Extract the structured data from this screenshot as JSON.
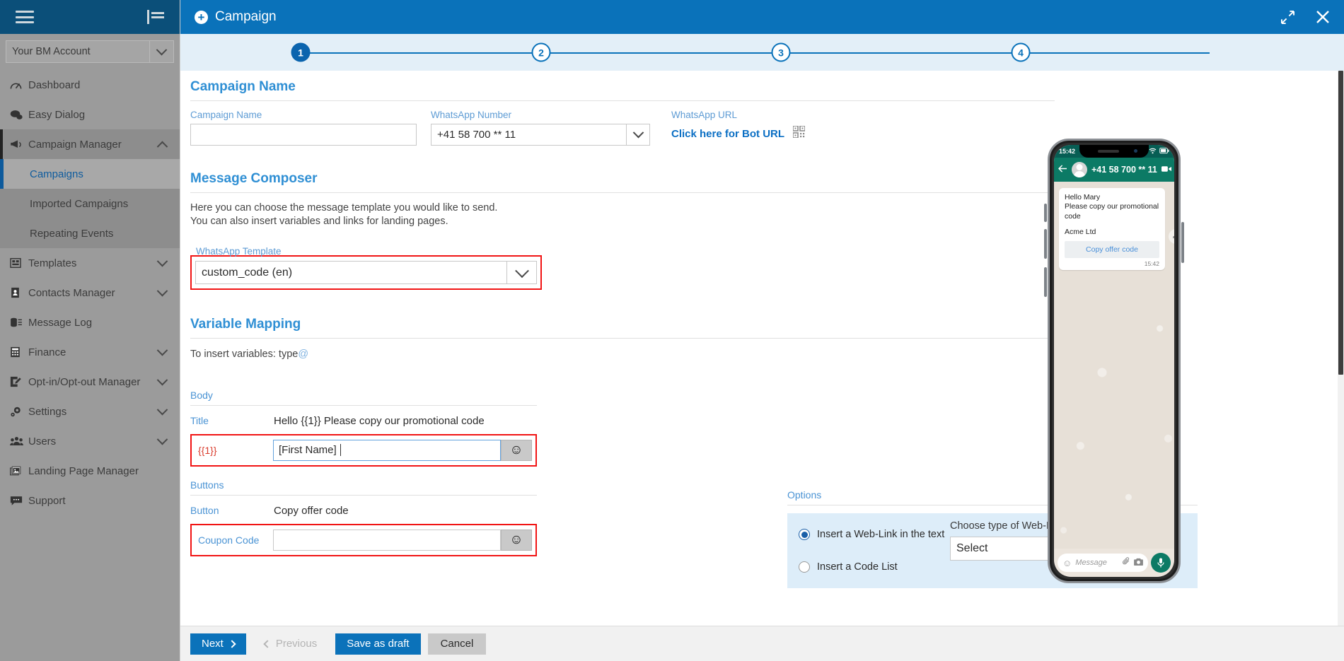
{
  "sidebar": {
    "account": {
      "label": "Your BM Account"
    },
    "items": [
      {
        "label": "Dashboard",
        "icon": "gauge-icon",
        "expandable": false
      },
      {
        "label": "Easy Dialog",
        "icon": "chat-bubbles-icon",
        "expandable": false
      },
      {
        "label": "Campaign Manager",
        "icon": "megaphone-icon",
        "expandable": true,
        "expanded": true
      },
      {
        "label": "Templates",
        "icon": "template-icon",
        "expandable": true
      },
      {
        "label": "Contacts Manager",
        "icon": "contacts-book-icon",
        "expandable": true
      },
      {
        "label": "Message Log",
        "icon": "database-list-icon",
        "expandable": false
      },
      {
        "label": "Finance",
        "icon": "calculator-icon",
        "expandable": true
      },
      {
        "label": "Opt-in/Opt-out Manager",
        "icon": "edit-square-icon",
        "expandable": true
      },
      {
        "label": "Settings",
        "icon": "gear-icon",
        "expandable": true
      },
      {
        "label": "Users",
        "icon": "users-icon",
        "expandable": true
      },
      {
        "label": "Landing Page Manager",
        "icon": "images-icon",
        "expandable": false
      },
      {
        "label": "Support",
        "icon": "support-chat-icon",
        "expandable": false
      }
    ],
    "submenu": [
      {
        "label": "Campaigns",
        "active": true
      },
      {
        "label": "Imported Campaigns",
        "active": false
      },
      {
        "label": "Repeating Events",
        "active": false
      }
    ]
  },
  "modal": {
    "title": "Campaign",
    "add_icon": "plus-circle-icon",
    "expand_icon": "expand-icon",
    "close_icon": "close-icon",
    "steps": [
      {
        "number": "1",
        "state": "done"
      },
      {
        "number": "2",
        "state": "todo"
      },
      {
        "number": "3",
        "state": "todo"
      },
      {
        "number": "4",
        "state": "todo"
      }
    ]
  },
  "campaign_name": {
    "heading": "Campaign Name",
    "name_label": "Campaign Name",
    "name_value": "",
    "whatsapp_number_label": "WhatsApp Number",
    "whatsapp_number_value": "+41 58 700 ** 11",
    "whatsapp_url_label": "WhatsApp URL",
    "bot_url_link": "Click here for Bot URL",
    "qr_icon": "qr-code-icon"
  },
  "message_composer": {
    "heading": "Message Composer",
    "hint_line1": "Here you can choose the message template you would like to send.",
    "hint_line2": "You can also insert variables and links for landing pages.",
    "template_label": "WhatsApp Template",
    "template_value": "custom_code (en)"
  },
  "variable_mapping": {
    "heading": "Variable Mapping",
    "hint_prefix": "To insert variables: type",
    "hint_symbol": "@",
    "body_header": "Body",
    "title_key": "Title",
    "title_value": "Hello {{1}} Please copy our promotional code",
    "var1_key": "{{1}}",
    "var1_value": "[First Name]",
    "buttons_header": "Buttons",
    "button_key": "Button",
    "button_value": "Copy offer code",
    "coupon_key": "Coupon Code",
    "coupon_value": "",
    "emoji_icon": "emoji-smiley-icon"
  },
  "options": {
    "heading": "Options",
    "radio_weblink": "Insert a Web-Link in the text",
    "radio_codelist": "Insert a Code List",
    "selected": "weblink",
    "weblink_type_label": "Choose type of Web-Link",
    "weblink_type_value": "Select"
  },
  "preview": {
    "status_time": "15:42",
    "battery_icon": "battery-icon",
    "wifi_icon": "wifi-icon",
    "signal_icon": "signal-icon",
    "back_icon": "back-arrow-icon",
    "avatar_icon": "avatar-icon",
    "contact": "+41 58 700 ** 11",
    "video_icon": "video-camera-icon",
    "call_icon": "phone-icon",
    "menu_icon": "kebab-menu-icon",
    "message_line1": "Hello Mary",
    "message_line2": "Please copy our promotional code",
    "company": "Acme Ltd",
    "cta_label": "Copy offer code",
    "message_time": "15:42",
    "forward_icon": "forward-arrow-icon",
    "composer_emoji_icon": "emoji-smiley-icon",
    "composer_placeholder": "Message",
    "attach_icon": "paperclip-icon",
    "camera_icon": "camera-icon",
    "mic_icon": "microphone-icon"
  },
  "footer": {
    "next": "Next",
    "previous": "Previous",
    "save_draft": "Save as draft",
    "cancel": "Cancel"
  },
  "colors": {
    "brand_blue": "#0a72ba",
    "sidebar_dark": "#0b4f79",
    "accent_link": "#2f8fd4",
    "highlight_red": "#f11414",
    "whatsapp_green": "#0c7a65"
  }
}
